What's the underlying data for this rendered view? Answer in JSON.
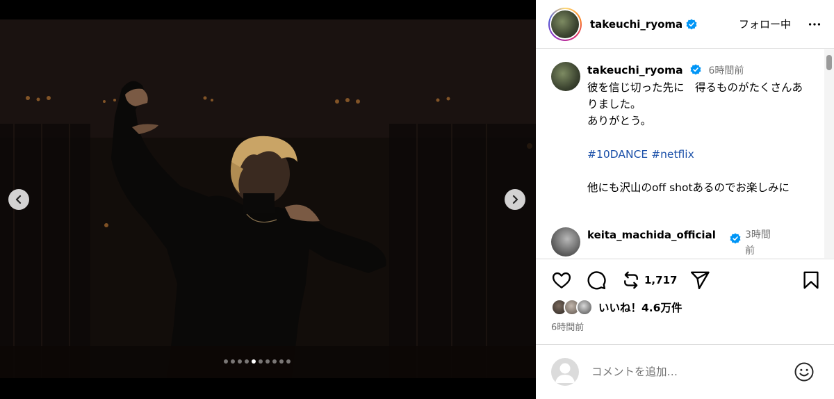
{
  "post": {
    "author": "takeuchi_ryoma",
    "follow_state": "フォロー中",
    "caption": {
      "username": "takeuchi_ryoma",
      "time": "6時間前",
      "line1": "彼を信じ切った先に　得るものがたくさんありました。",
      "line2": "ありがとう。",
      "hashtags": "#10DANCE #netflix",
      "line3": "他にも沢山のoff shotあるのでお楽しみに"
    },
    "reply": {
      "username": "keita_machida_official",
      "time": "3時間前"
    },
    "repost_count": "1,717",
    "likes_text": "いいね！4.6万件",
    "posted": "6時間前",
    "comment_placeholder": "コメントを追加…"
  },
  "media": {
    "slide_count": 10,
    "active_slide": 5
  },
  "colors": {
    "accent_link": "#1a4fa8",
    "verified": "#0095f6",
    "muted_text": "#737373"
  },
  "icons": [
    "chevron-left-icon",
    "chevron-right-icon",
    "verified-icon",
    "more-icon",
    "heart-icon",
    "comment-icon",
    "repost-icon",
    "share-icon",
    "bookmark-icon",
    "emoji-icon"
  ]
}
